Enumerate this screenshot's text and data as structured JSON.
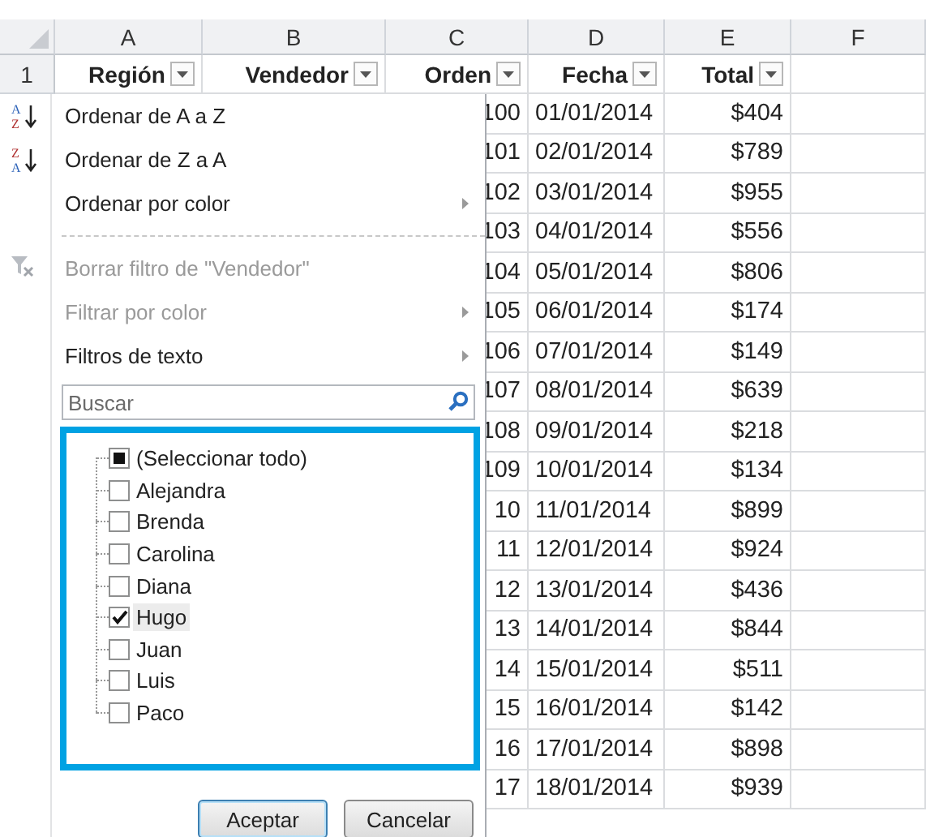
{
  "sheet": {
    "column_letters": [
      "A",
      "B",
      "C",
      "D",
      "E",
      "F"
    ],
    "row_number": "1",
    "headers": [
      {
        "label": "Región"
      },
      {
        "label": "Vendedor"
      },
      {
        "label": "Orden"
      },
      {
        "label": "Fecha"
      },
      {
        "label": "Total"
      }
    ],
    "rows": [
      {
        "orden": "100",
        "fecha": "01/01/2014",
        "total": "$404"
      },
      {
        "orden": "101",
        "fecha": "02/01/2014",
        "total": "$789"
      },
      {
        "orden": "102",
        "fecha": "03/01/2014",
        "total": "$955"
      },
      {
        "orden": "103",
        "fecha": "04/01/2014",
        "total": "$556"
      },
      {
        "orden": "104",
        "fecha": "05/01/2014",
        "total": "$806"
      },
      {
        "orden": "105",
        "fecha": "06/01/2014",
        "total": "$174"
      },
      {
        "orden": "106",
        "fecha": "07/01/2014",
        "total": "$149"
      },
      {
        "orden": "107",
        "fecha": "08/01/2014",
        "total": "$639"
      },
      {
        "orden": "108",
        "fecha": "09/01/2014",
        "total": "$218"
      },
      {
        "orden": "109",
        "fecha": "10/01/2014",
        "total": "$134"
      },
      {
        "orden": "10",
        "fecha": "11/01/2014",
        "total": "$899"
      },
      {
        "orden": "11",
        "fecha": "12/01/2014",
        "total": "$924"
      },
      {
        "orden": "12",
        "fecha": "13/01/2014",
        "total": "$436"
      },
      {
        "orden": "13",
        "fecha": "14/01/2014",
        "total": "$844"
      },
      {
        "orden": "14",
        "fecha": "15/01/2014",
        "total": "$511"
      },
      {
        "orden": "15",
        "fecha": "16/01/2014",
        "total": "$142"
      },
      {
        "orden": "16",
        "fecha": "17/01/2014",
        "total": "$898"
      },
      {
        "orden": "17",
        "fecha": "18/01/2014",
        "total": "$939"
      }
    ]
  },
  "filter_menu": {
    "items": [
      {
        "kind": "sort",
        "label": "Ordenar de A a Z",
        "icon_letters": [
          "A",
          "Z"
        ],
        "disabled": false,
        "submenu": false
      },
      {
        "kind": "sort",
        "label": "Ordenar de Z a A",
        "icon_letters": [
          "Z",
          "A"
        ],
        "disabled": false,
        "submenu": false
      },
      {
        "kind": "item",
        "label": "Ordenar por color",
        "disabled": false,
        "submenu": true
      },
      {
        "kind": "separator"
      },
      {
        "kind": "clear",
        "label": "Borrar filtro de \"Vendedor\"",
        "disabled": true,
        "submenu": false
      },
      {
        "kind": "item",
        "label": "Filtrar por color",
        "disabled": true,
        "submenu": true
      },
      {
        "kind": "item",
        "label": "Filtros de texto",
        "disabled": false,
        "submenu": true
      }
    ],
    "search": {
      "placeholder": "Buscar"
    },
    "values": [
      {
        "kind": "select_all",
        "label": "(Seleccionar todo)",
        "checked": false,
        "selected": false
      },
      {
        "kind": "value",
        "label": "Alejandra",
        "checked": false,
        "selected": false
      },
      {
        "kind": "value",
        "label": "Brenda",
        "checked": false,
        "selected": false
      },
      {
        "kind": "value",
        "label": "Carolina",
        "checked": false,
        "selected": false
      },
      {
        "kind": "value",
        "label": "Diana",
        "checked": false,
        "selected": false
      },
      {
        "kind": "value",
        "label": "Hugo",
        "checked": true,
        "selected": true
      },
      {
        "kind": "value",
        "label": "Juan",
        "checked": false,
        "selected": false
      },
      {
        "kind": "value",
        "label": "Luis",
        "checked": false,
        "selected": false
      },
      {
        "kind": "value",
        "label": "Paco",
        "checked": false,
        "selected": false
      }
    ],
    "buttons": [
      {
        "label": "Aceptar",
        "focused": true
      },
      {
        "label": "Cancelar",
        "focused": false
      }
    ]
  }
}
